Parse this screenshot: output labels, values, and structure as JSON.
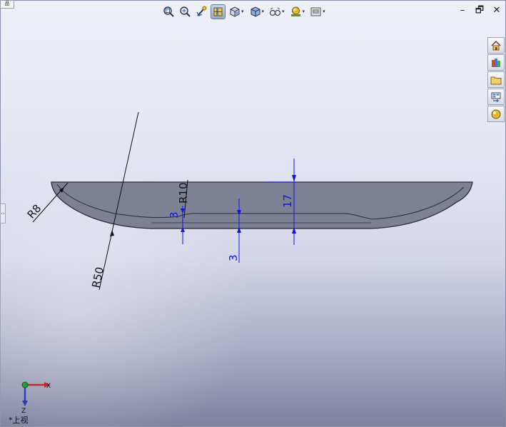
{
  "corner_tab": {
    "label": "品"
  },
  "toolbar": {
    "buttons": [
      {
        "name": "zoom-to-fit-icon",
        "active": false,
        "dropdown": false
      },
      {
        "name": "zoom-to-area-icon",
        "active": false,
        "dropdown": false
      },
      {
        "name": "previous-view-icon",
        "active": false,
        "dropdown": false
      },
      {
        "name": "section-view-icon",
        "active": true,
        "dropdown": false
      },
      {
        "name": "view-orientation-icon",
        "active": false,
        "dropdown": true
      },
      {
        "name": "display-style-icon",
        "active": false,
        "dropdown": true
      },
      {
        "name": "hide-show-items-icon",
        "active": false,
        "dropdown": true
      },
      {
        "name": "edit-appearance-icon",
        "active": false,
        "dropdown": true
      },
      {
        "name": "apply-scene-icon",
        "active": false,
        "dropdown": true
      }
    ],
    "dropdown_glyph": "▾"
  },
  "window_controls": {
    "minimize": "–",
    "restore": "🗗",
    "close": "✕"
  },
  "taskpane": {
    "items": [
      "solidworks-resources-icon",
      "design-library-icon",
      "file-explorer-icon",
      "view-palette-icon",
      "appearances-scenes-icon"
    ]
  },
  "side_handle": {
    "glyph": "‹›"
  },
  "drawing": {
    "dimensions": {
      "r8": "R8",
      "r10": "R10",
      "r50": "R50",
      "thickness_left": "3",
      "thickness_mid": "3",
      "depth": "17"
    },
    "colors": {
      "part_fill": "#7d8194",
      "part_top": "#6f7386",
      "part_edge": "#2a2c36",
      "dimension": "#1414e6",
      "leader": "#111111"
    }
  },
  "triad": {
    "x_label": "X",
    "z_label": "Z"
  },
  "view_label": {
    "text": "*上视"
  }
}
